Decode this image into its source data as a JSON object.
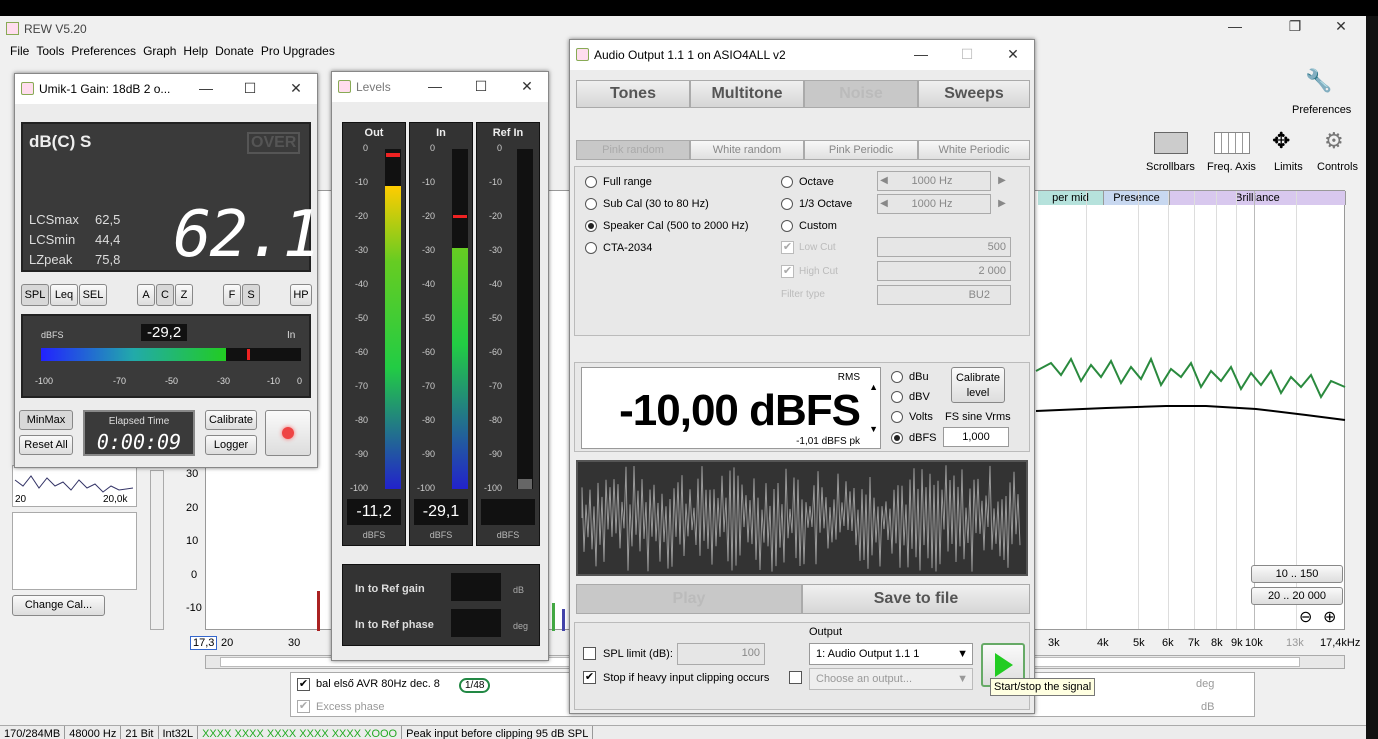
{
  "app": {
    "title": "REW V5.20",
    "menu": [
      "File",
      "Tools",
      "Preferences",
      "Graph",
      "Help",
      "Donate",
      "Pro Upgrades"
    ],
    "toolbar_right": [
      "Preferences",
      "Scrollbars",
      "Freq. Axis",
      "Limits",
      "Controls"
    ],
    "bands": [
      "per mid",
      "Presence",
      "Brilliance"
    ],
    "x_ticks": [
      "17,3",
      "20",
      "30",
      "3k",
      "4k",
      "5k",
      "6k",
      "7k",
      "8k",
      "9k",
      "10k",
      "13k",
      "17,4kHz"
    ],
    "y_ticks": [
      "30",
      "20",
      "10",
      "0",
      "-10"
    ],
    "range_buttons": [
      "10 .. 150",
      "20 .. 20 000"
    ],
    "zoom": [
      "⊖",
      "⊕"
    ],
    "measurement": {
      "name": "bal első AVR 80Hz dec. 8",
      "smoothing": "1/48",
      "excess": "Excess phase",
      "unit_deg": "deg",
      "unit_db": "dB"
    },
    "status": [
      "170/284MB",
      "48000 Hz",
      "21 Bit",
      "Int32L",
      "XXXX XXXX   XXXX XXXX   XXXX XOOO",
      "Peak input before clipping 95 dB SPL"
    ],
    "side": {
      "freq_left": "20",
      "freq_right": "20,0k",
      "change_cal": "Change Cal..."
    }
  },
  "umik": {
    "title": "Umik-1  Gain: 18dB  2 o...",
    "mode": "dB(C) S",
    "over": "OVER",
    "value": "62.1",
    "stats": [
      {
        "k": "LCSmax",
        "v": "62,5"
      },
      {
        "k": "LCSmin",
        "v": "44,4"
      },
      {
        "k": "LZpeak",
        "v": "75,8"
      }
    ],
    "buttons": [
      "SPL",
      "Leq",
      "SEL",
      "A",
      "C",
      "Z",
      "F",
      "S",
      "HP"
    ],
    "dbfs_label": "dBFS",
    "dbfs_value": "-29,2",
    "in_label": "In",
    "dbfs_fill": 0.71,
    "scale": [
      "-100",
      "-70",
      "-50",
      "-30",
      "-10",
      "0"
    ],
    "minmax": "MinMax",
    "resetall": "Reset All",
    "elapsed_label": "Elapsed Time",
    "elapsed": "0:00:09",
    "calibrate": "Calibrate",
    "logger": "Logger"
  },
  "levels": {
    "title": "Levels",
    "cols": [
      "Out",
      "In",
      "Ref In"
    ],
    "values": [
      "-11,2",
      "-29,1",
      ""
    ],
    "unit": "dBFS",
    "scale": [
      "0",
      "-10",
      "-20",
      "-30",
      "-40",
      "-50",
      "-60",
      "-70",
      "-80",
      "-90",
      "-100"
    ],
    "out_fill": 0.89,
    "in_fill": 0.71,
    "ref_gain": "In to Ref gain",
    "ref_gain_unit": "dB",
    "ref_phase": "In to Ref phase",
    "ref_phase_unit": "deg"
  },
  "audio": {
    "title": "Audio Output 1.1 1 on ASIO4ALL v2",
    "tabs": [
      "Tones",
      "Multitone",
      "Noise",
      "Sweeps"
    ],
    "subtabs": [
      "Pink random",
      "White random",
      "Pink Periodic",
      "White Periodic"
    ],
    "options": [
      "Full range",
      "Sub Cal (30 to 80 Hz)",
      "Speaker Cal (500 to 2000 Hz)",
      "CTA-2034"
    ],
    "options2": [
      "Octave",
      "1/3 Octave",
      "Custom"
    ],
    "freq1": "1000 Hz",
    "freq2": "1000 Hz",
    "lowcut": "Low Cut",
    "highcut": "High Cut",
    "lowcut_val": "500",
    "highcut_val": "2 000",
    "filter_type": "Filter type",
    "filter_val": "BU2",
    "rms": "RMS",
    "level": "-10,00 dBFS",
    "peak": "-1,01 dBFS pk",
    "units": [
      "dBu",
      "dBV",
      "Volts",
      "dBFS"
    ],
    "calibrate": "Calibrate level",
    "fs_sine": "FS sine Vrms",
    "fs_val": "1,000",
    "play": "Play",
    "save": "Save to file",
    "spl_limit": "SPL limit (dB):",
    "spl_val": "100",
    "stop_clip": "Stop if heavy input clipping occurs",
    "output_label": "Output",
    "output_val": "1: Audio Output 1.1 1",
    "output_placeholder": "Choose an output...",
    "tooltip": "Start/stop the signal"
  }
}
